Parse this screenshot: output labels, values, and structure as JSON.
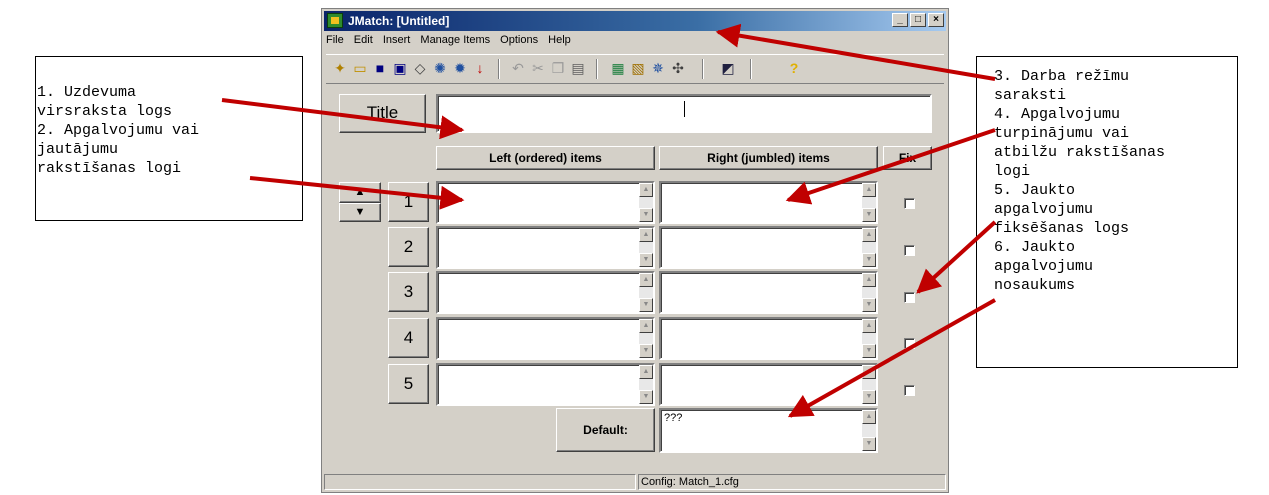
{
  "window": {
    "title": "JMatch: [Untitled]",
    "controls": {
      "minimize": "_",
      "maximize": "□",
      "close": "×"
    },
    "menu": [
      "File",
      "Edit",
      "Insert",
      "Manage Items",
      "Options",
      "Help"
    ],
    "title_button": "Title",
    "title_value": "",
    "columns": {
      "left": "Left (ordered) items",
      "right": "Right (jumbled) items",
      "fix": "Fix"
    },
    "rows": [
      {
        "number": "1",
        "left": "",
        "right": "",
        "fixed": false
      },
      {
        "number": "2",
        "left": "",
        "right": "",
        "fixed": false
      },
      {
        "number": "3",
        "left": "",
        "right": "",
        "fixed": false
      },
      {
        "number": "4",
        "left": "",
        "right": "",
        "fixed": false
      },
      {
        "number": "5",
        "left": "",
        "right": "",
        "fixed": false
      }
    ],
    "default_label": "Default:",
    "default_value": "???",
    "status": "Config: Match_1.cfg"
  },
  "callouts": {
    "left": [
      "1. Uzdevuma",
      "virsraksta logs",
      "2. Apgalvojumu vai",
      "jautājumu",
      "rakstīšanas logi"
    ],
    "right": [
      "3. Darba režīmu",
      "saraksti",
      "4. Apgalvojumu",
      "turpinājumu vai",
      "atbilžu rakstīšanas",
      "logi",
      "5. Jaukto",
      "apgalvojumu",
      "fiksēšanas logs",
      "6. Jaukto",
      "apgalvojumu",
      "nosaukums"
    ]
  },
  "colors": {
    "arrow": "#c00000",
    "face": "#d4d0c8",
    "titlebar": "#0a246a"
  }
}
